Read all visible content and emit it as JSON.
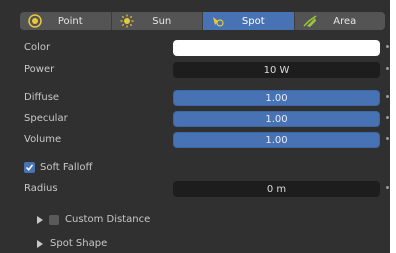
{
  "tabs": [
    {
      "label": "Point",
      "icon": "point-light-icon",
      "active": false
    },
    {
      "label": "Sun",
      "icon": "sun-light-icon",
      "active": false
    },
    {
      "label": "Spot",
      "icon": "spot-light-icon",
      "active": true
    },
    {
      "label": "Area",
      "icon": "area-light-icon",
      "active": false
    }
  ],
  "properties": {
    "color_label": "Color",
    "color_value": "#ffffff",
    "power_label": "Power",
    "power_value": "10 W",
    "diffuse_label": "Diffuse",
    "diffuse_value": "1.00",
    "specular_label": "Specular",
    "specular_value": "1.00",
    "volume_label": "Volume",
    "volume_value": "1.00",
    "soft_falloff_label": "Soft Falloff",
    "soft_falloff_checked": true,
    "radius_label": "Radius",
    "radius_value": "0 m"
  },
  "subpanels": {
    "custom_distance_label": "Custom Distance",
    "custom_distance_checked": false,
    "spot_shape_label": "Spot Shape"
  },
  "colors": {
    "accent": "#4772b3",
    "panel_bg": "#303030",
    "field_bg": "#1d1d1d"
  }
}
